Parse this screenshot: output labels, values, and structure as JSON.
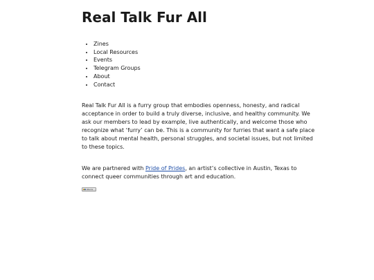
{
  "site": {
    "title": "Real Talk Fur All"
  },
  "nav": {
    "items": [
      {
        "label": "Zines"
      },
      {
        "label": "Local Resources"
      },
      {
        "label": "Events"
      },
      {
        "label": "Telegram Groups"
      },
      {
        "label": "About"
      },
      {
        "label": "Contact"
      }
    ]
  },
  "intro": {
    "lines": [
      "Real Talk Fur All is a furry group that embodies openness, honesty, and radical",
      "acceptance in order to build a truly diverse, inclusive, and healthy community. We",
      "ask our members to lead by example, live authentically, and welcome those who",
      "recognize what ‘furry’ can be. This is a community for furries that want a safe place",
      "to talk about mental health, personal struggles, and societal issues, but not limited",
      "to these topics."
    ]
  },
  "partner": {
    "text_before": "We are partnered with ",
    "link_text": "Pride of Prides",
    "text_after": ", an artist’s collective in Austin, Texas to",
    "line2": "connect queer communities through art and education."
  },
  "badge": {
    "text": "88x31"
  }
}
